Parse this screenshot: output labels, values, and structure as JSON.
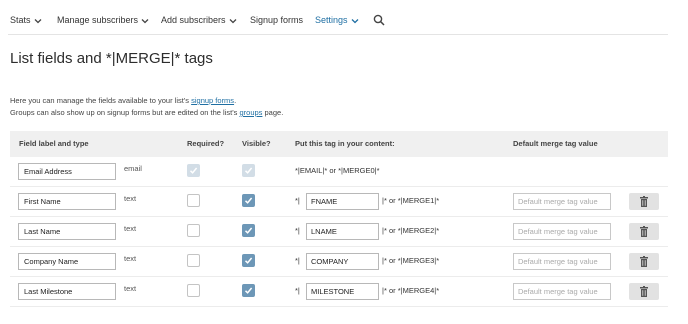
{
  "nav": {
    "items": [
      {
        "label": "Stats",
        "chevron": true,
        "active": false
      },
      {
        "label": "Manage subscribers",
        "chevron": true,
        "active": false
      },
      {
        "label": "Add subscribers",
        "chevron": true,
        "active": false
      },
      {
        "label": "Signup forms",
        "chevron": false,
        "active": false
      },
      {
        "label": "Settings",
        "chevron": true,
        "active": true
      }
    ],
    "search_icon": "search-icon"
  },
  "page": {
    "title": "List fields and *|MERGE|* tags"
  },
  "intro": {
    "line1_before": "Here you can manage the fields available to your list's ",
    "line1_link": "signup forms",
    "line1_after": ".",
    "line2_before": "Groups can also show up on signup forms but are edited on the list's ",
    "line2_link": "groups",
    "line2_after": " page."
  },
  "table": {
    "headers": {
      "field": "Field label and type",
      "required": "Required?",
      "visible": "Visible?",
      "tag": "Put this tag in your content:",
      "default": "Default merge tag value"
    },
    "rows": [
      {
        "label": "Email Address",
        "type": "email",
        "required": true,
        "visible": true,
        "locked": true,
        "tag_full": "*|EMAIL|* or *|MERGE0|*"
      },
      {
        "label": "First Name",
        "type": "text",
        "required": false,
        "visible": true,
        "locked": false,
        "tag_prefix": "*|",
        "tag": "FNAME",
        "tag_suffix": "|* or *|MERGE1|*",
        "default_placeholder": "Default merge tag value"
      },
      {
        "label": "Last Name",
        "type": "text",
        "required": false,
        "visible": true,
        "locked": false,
        "tag_prefix": "*|",
        "tag": "LNAME",
        "tag_suffix": "|* or *|MERGE2|*",
        "default_placeholder": "Default merge tag value"
      },
      {
        "label": "Company Name",
        "type": "text",
        "required": false,
        "visible": true,
        "locked": false,
        "tag_prefix": "*|",
        "tag": "COMPANY",
        "tag_suffix": "|* or *|MERGE3|*",
        "default_placeholder": "Default merge tag value"
      },
      {
        "label": "Last Milestone",
        "type": "text",
        "required": false,
        "visible": true,
        "locked": false,
        "tag_prefix": "*|",
        "tag": "MILESTONE",
        "tag_suffix": "|* or *|MERGE4|*",
        "default_placeholder": "Default merge tag value"
      }
    ]
  },
  "colors": {
    "accent": "#1f6fa3",
    "checkbox_checked": "#6d97b7",
    "checkbox_disabled": "#d2dde6",
    "header_bg": "#f0f0f0"
  }
}
